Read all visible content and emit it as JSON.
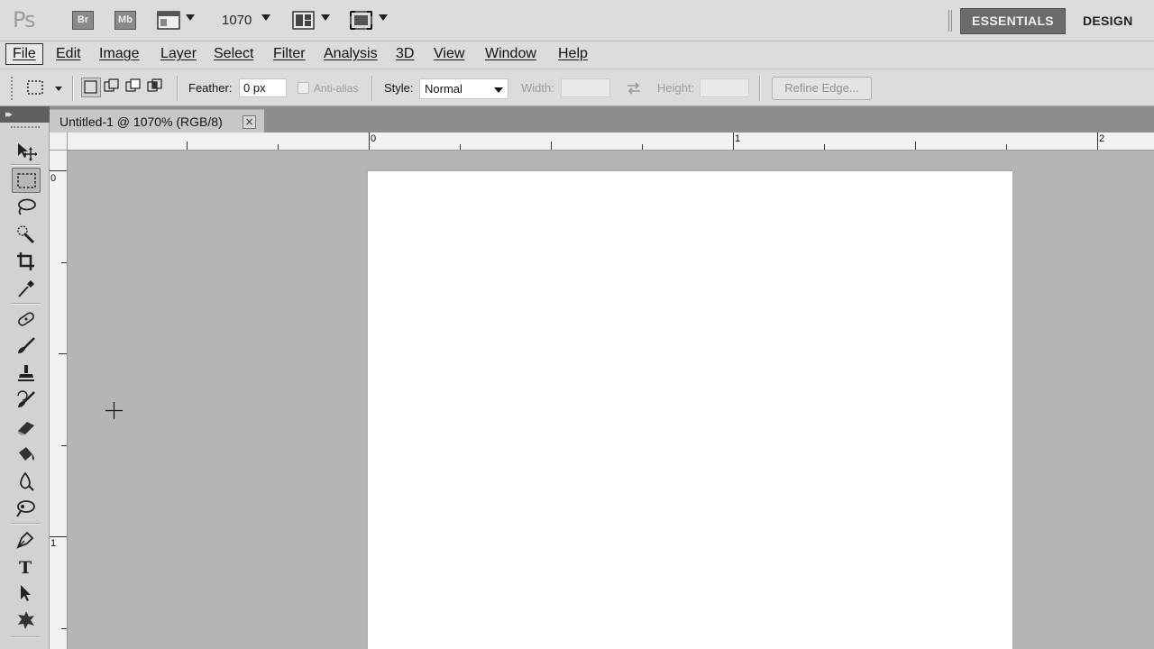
{
  "appbar": {
    "logo": "Ps",
    "bridge_label": "Br",
    "minibridge_label": "Mb",
    "zoom": "1070",
    "workspaces": {
      "essentials": "ESSENTIALS",
      "design": "DESIGN"
    }
  },
  "menu": {
    "file": "File",
    "edit": "Edit",
    "image": "Image",
    "layer": "Layer",
    "select": "Select",
    "filter": "Filter",
    "analysis": "Analysis",
    "three_d": "3D",
    "view": "View",
    "window": "Window",
    "help": "Help"
  },
  "options": {
    "feather_label": "Feather:",
    "feather_value": "0 px",
    "antialias_label": "Anti-alias",
    "style_label": "Style:",
    "style_value": "Normal",
    "width_label": "Width:",
    "height_label": "Height:",
    "refine_edge": "Refine Edge..."
  },
  "document": {
    "tab_title": "Untitled-1 @ 1070% (RGB/8)",
    "close_glyph": "×"
  },
  "rulers": {
    "h_labels": [
      "0",
      "1",
      "2"
    ],
    "v_labels": [
      "0",
      "1"
    ]
  },
  "colors": {
    "chrome": "#dcdcdc",
    "pasteboard": "#b5b5b5",
    "canvas": "#ffffff",
    "active_workspace": "#6b6b6b"
  },
  "tools": [
    "move-tool-icon",
    "rectangular-marquee-icon",
    "lasso-icon",
    "quick-selection-icon",
    "crop-icon",
    "eyedropper-icon",
    "healing-brush-icon",
    "brush-icon",
    "clone-stamp-icon",
    "history-brush-icon",
    "eraser-icon",
    "paint-bucket-icon",
    "dodge-icon",
    "blur-icon",
    "pen-icon",
    "type-icon",
    "path-selection-icon",
    "custom-shape-icon"
  ]
}
